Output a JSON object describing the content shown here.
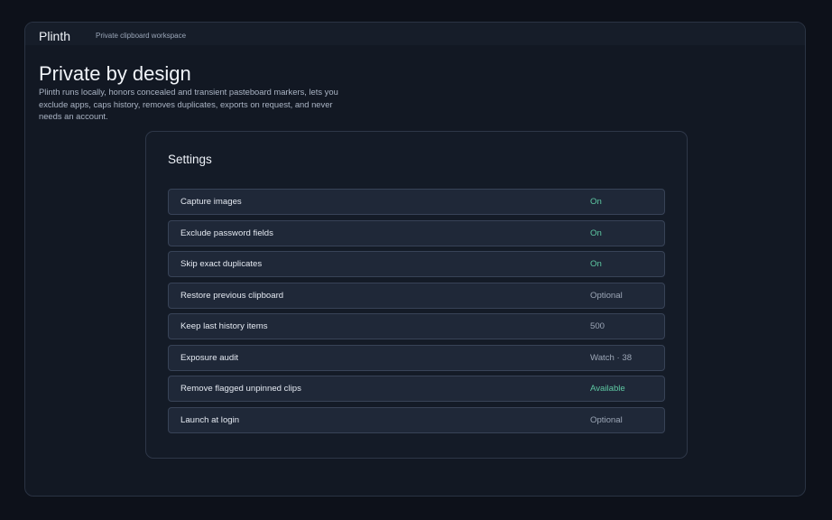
{
  "app": {
    "name": "Plinth",
    "workspace": "Private clipboard workspace"
  },
  "hero": {
    "title": "Private by design",
    "description": "Plinth runs locally, honors concealed and transient pasteboard markers, lets you exclude apps, caps history, removes duplicates, exports on request, and never needs an account."
  },
  "settings": {
    "title": "Settings",
    "rows": [
      {
        "label": "Capture images",
        "value": "On",
        "status_color": "#5ec9a3"
      },
      {
        "label": "Exclude password fields",
        "value": "On",
        "status_color": "#5ec9a3"
      },
      {
        "label": "Skip exact duplicates",
        "value": "On",
        "status_color": "#5ec9a3"
      },
      {
        "label": "Restore previous clipboard",
        "value": "Optional",
        "status_color": "#9ca6b6"
      },
      {
        "label": "Keep last history items",
        "value": "500",
        "status_color": "#9ca6b6"
      },
      {
        "label": "Exposure audit",
        "value": "Watch · 38",
        "status_color": "#9ca6b6"
      },
      {
        "label": "Remove flagged unpinned clips",
        "value": "Available",
        "status_color": "#5ec9a3"
      },
      {
        "label": "Launch at login",
        "value": "Optional",
        "status_color": "#9ca6b6"
      }
    ]
  }
}
